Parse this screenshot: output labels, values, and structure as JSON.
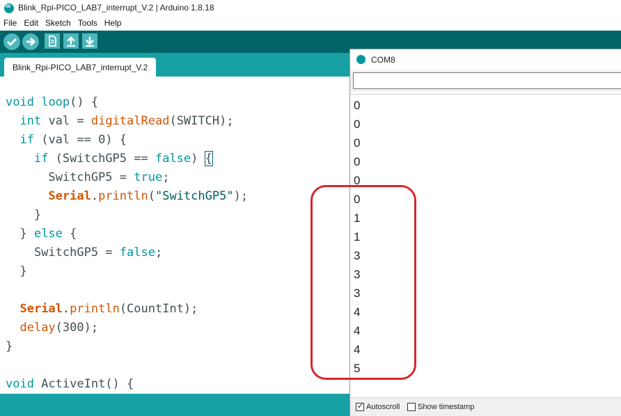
{
  "window": {
    "title": "Blink_Rpi-PICO_LAB7_interrupt_V.2 | Arduino 1.8.18"
  },
  "menu": [
    "File",
    "Edit",
    "Sketch",
    "Tools",
    "Help"
  ],
  "toolbar": {
    "buttons": [
      {
        "name": "verify-button",
        "icon": "checkmark-icon"
      },
      {
        "name": "upload-button",
        "icon": "arrow-right-icon"
      },
      {
        "name": "new-button",
        "icon": "new-file-icon"
      },
      {
        "name": "open-button",
        "icon": "arrow-up-icon"
      },
      {
        "name": "save-button",
        "icon": "arrow-down-icon"
      }
    ]
  },
  "tabs": [
    {
      "label": "Blink_Rpi-PICO_LAB7_interrupt_V.2",
      "active": true
    }
  ],
  "editor": {
    "lines": [
      [
        {
          "t": "void",
          "c": "kw"
        },
        {
          "t": " "
        },
        {
          "t": "loop",
          "c": "kw"
        },
        {
          "t": "() {"
        }
      ],
      [
        {
          "t": "  "
        },
        {
          "t": "int",
          "c": "kw"
        },
        {
          "t": " val = "
        },
        {
          "t": "digitalRead",
          "c": "fn"
        },
        {
          "t": "(SWITCH);"
        }
      ],
      [
        {
          "t": "  "
        },
        {
          "t": "if",
          "c": "kw"
        },
        {
          "t": " (val == 0) {"
        }
      ],
      [
        {
          "t": "    "
        },
        {
          "t": "if",
          "c": "kw"
        },
        {
          "t": " (SwitchGP5 == "
        },
        {
          "t": "false",
          "c": "kw"
        },
        {
          "t": ") "
        },
        {
          "t": "{",
          "c": "brace-hl"
        }
      ],
      [
        {
          "t": "      SwitchGP5 = "
        },
        {
          "t": "true",
          "c": "kw"
        },
        {
          "t": ";"
        }
      ],
      [
        {
          "t": "      "
        },
        {
          "t": "Serial",
          "c": "cls"
        },
        {
          "t": "."
        },
        {
          "t": "println",
          "c": "fn"
        },
        {
          "t": "("
        },
        {
          "t": "\"SwitchGP5\"",
          "c": "str"
        },
        {
          "t": ");"
        }
      ],
      [
        {
          "t": "    }"
        }
      ],
      [
        {
          "t": "  } "
        },
        {
          "t": "else",
          "c": "kw"
        },
        {
          "t": " {"
        }
      ],
      [
        {
          "t": "    SwitchGP5 = "
        },
        {
          "t": "false",
          "c": "kw"
        },
        {
          "t": ";"
        }
      ],
      [
        {
          "t": "  }"
        }
      ],
      [
        {
          "t": ""
        }
      ],
      [
        {
          "t": "  "
        },
        {
          "t": "Serial",
          "c": "cls"
        },
        {
          "t": "."
        },
        {
          "t": "println",
          "c": "fn"
        },
        {
          "t": "(CountInt);"
        }
      ],
      [
        {
          "t": "  "
        },
        {
          "t": "delay",
          "c": "fn"
        },
        {
          "t": "(300);"
        }
      ],
      [
        {
          "t": "}"
        }
      ],
      [
        {
          "t": ""
        }
      ],
      [
        {
          "t": "void",
          "c": "kw"
        },
        {
          "t": " ActiveInt() {"
        }
      ]
    ]
  },
  "serial_monitor": {
    "title": "COM8",
    "input_value": "",
    "output": [
      "0",
      "0",
      "0",
      "0",
      "0",
      "0",
      "1",
      "1",
      "3",
      "3",
      "3",
      "4",
      "4",
      "4",
      "5"
    ],
    "autoscroll": {
      "label": "Autoscroll",
      "checked": true
    },
    "show_timestamp": {
      "label": "Show timestamp",
      "checked": false
    }
  },
  "colors": {
    "toolbar": "#006468",
    "tabstrip": "#17a1a5",
    "button": "#4db7bb",
    "keyword": "#00979d",
    "function": "#d35400",
    "annotation": "#d7262f"
  }
}
